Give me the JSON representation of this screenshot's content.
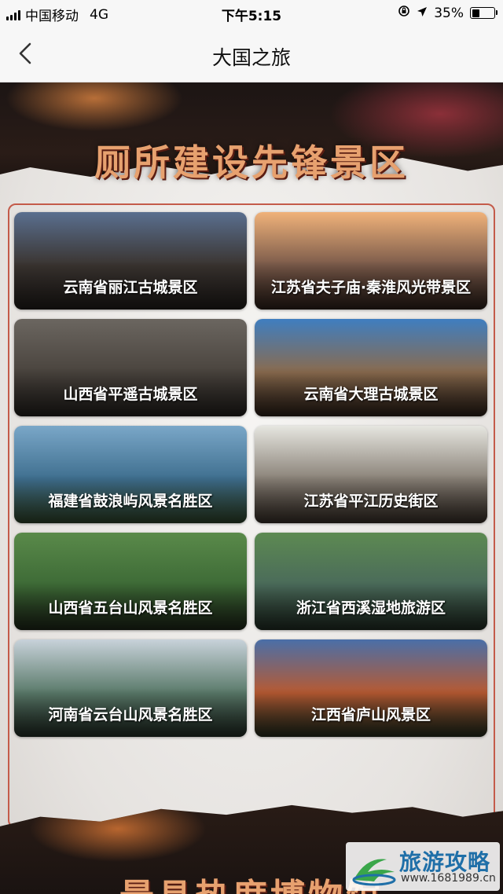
{
  "status_bar": {
    "carrier": "中国移动",
    "network": "4G",
    "time": "下午5:15",
    "battery": "35%",
    "battery_level": 0.35
  },
  "nav": {
    "back_icon": "chevron-left-icon",
    "title": "大国之旅"
  },
  "banner": {
    "title": "厕所建设先锋景区"
  },
  "attractions": [
    {
      "name": "云南省丽江古城景区",
      "colors": [
        "#5a6f8f",
        "#3a3430",
        "#2a2522"
      ]
    },
    {
      "name": "江苏省夫子庙·秦淮风光带景区",
      "colors": [
        "#f0b27a",
        "#7a5a4a",
        "#3b2a22"
      ]
    },
    {
      "name": "山西省平遥古城景区",
      "colors": [
        "#6b6660",
        "#4a443e",
        "#2e2a26"
      ]
    },
    {
      "name": "云南省大理古城景区",
      "colors": [
        "#3f7ec0",
        "#8a6b4e",
        "#3a2a20"
      ]
    },
    {
      "name": "福建省鼓浪屿风景名胜区",
      "colors": [
        "#7aa7c8",
        "#3f6f8f",
        "#3e5a3a"
      ]
    },
    {
      "name": "江苏省平江历史街区",
      "colors": [
        "#e6e6e0",
        "#8a8278",
        "#4a3f36"
      ]
    },
    {
      "name": "山西省五台山风景名胜区",
      "colors": [
        "#5a8a4a",
        "#3d6a36",
        "#26331f"
      ]
    },
    {
      "name": "浙江省西溪湿地旅游区",
      "colors": [
        "#5d8a52",
        "#4a6a5a",
        "#2a3a2e"
      ]
    },
    {
      "name": "河南省云台山风景名胜区",
      "colors": [
        "#c8d2da",
        "#5a7a6a",
        "#2b3a30"
      ]
    },
    {
      "name": "江西省庐山风景区",
      "colors": [
        "#4a6fa8",
        "#b75a32",
        "#2f3a26"
      ]
    }
  ],
  "banner2": {
    "title": "最具热度博物馆"
  },
  "watermark": {
    "brand": "旅游攻略",
    "url": "www.1681989.cn",
    "logo_icon": "travel-logo-icon"
  }
}
